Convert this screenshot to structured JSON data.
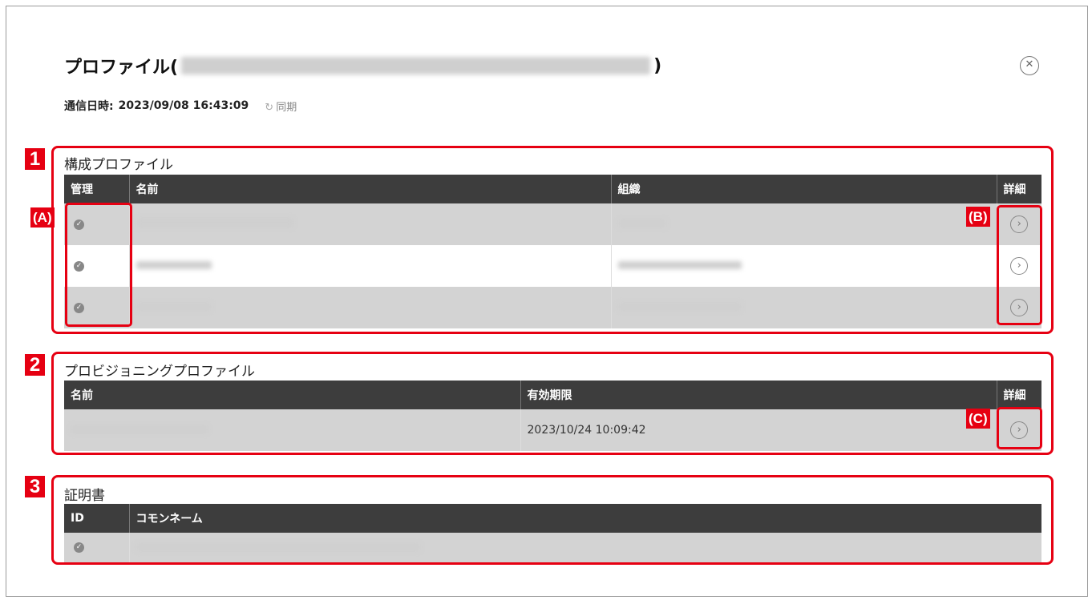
{
  "dialog": {
    "title_prefix": "プロファイル(",
    "title_suffix": ")",
    "comm_label": "通信日時:",
    "comm_datetime": "2023/09/08 16:43:09",
    "sync_label": "同期"
  },
  "sections": {
    "config": {
      "number": "1",
      "label": "構成プロファイル",
      "columns": [
        "管理",
        "名前",
        "組織",
        "詳細"
      ],
      "annotation_a": "(A)",
      "annotation_b": "(B)"
    },
    "provisioning": {
      "number": "2",
      "label": "プロビジョニングプロファイル",
      "columns": [
        "名前",
        "有効期限",
        "詳細"
      ],
      "rows": [
        {
          "expiry": "2023/10/24 10:09:42"
        }
      ],
      "annotation_c": "(C)"
    },
    "certificate": {
      "number": "3",
      "label": "証明書",
      "columns": [
        "ID",
        "コモンネーム"
      ]
    }
  },
  "icons": {
    "close": "close-circle-icon",
    "sync": "refresh-icon",
    "check": "check-circle-icon",
    "detail": "chevron-right-circle-icon"
  },
  "colors": {
    "accent": "#e60012",
    "header_bg": "#3d3d3d",
    "row_shade": "#d3d3d3"
  }
}
